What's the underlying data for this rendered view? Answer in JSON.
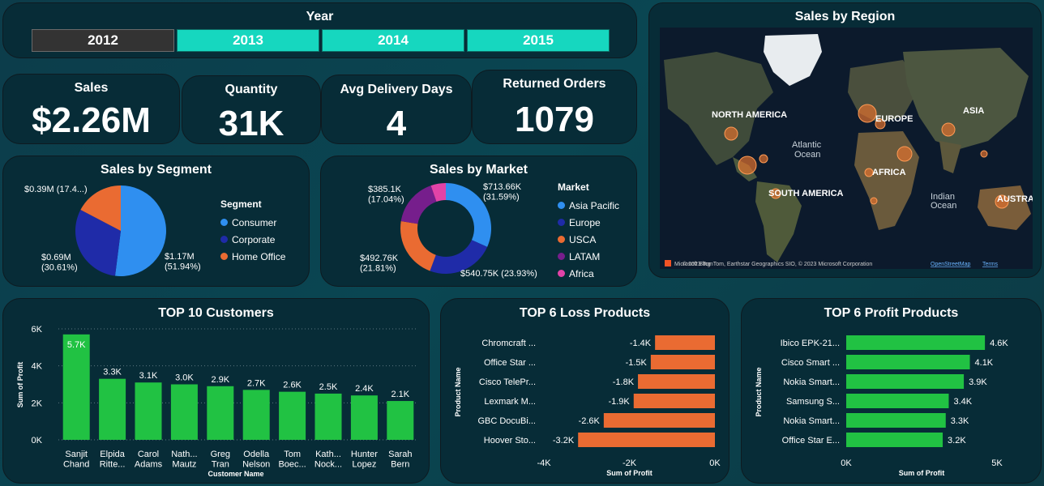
{
  "year_slicer": {
    "title": "Year",
    "years": [
      "2012",
      "2013",
      "2014",
      "2015"
    ],
    "selected": "2012"
  },
  "kpis": [
    {
      "label": "Sales",
      "value": "$2.26M"
    },
    {
      "label": "Quantity",
      "value": "31K"
    },
    {
      "label": "Avg Delivery Days",
      "value": "4"
    },
    {
      "label": "Returned Orders",
      "value": "1079"
    }
  ],
  "map": {
    "title": "Sales by Region",
    "labels": [
      "NORTH AMERICA",
      "EUROPE",
      "ASIA",
      "AFRICA",
      "SOUTH AMERICA",
      "AUSTRA",
      "Atlantic",
      "Ocean",
      "Indian",
      "Ocean"
    ],
    "attribution": "© 2023 TomTom, Earthstar Geographics SIO, © 2023 Microsoft Corporation",
    "attribution_links": [
      "OpenStreetMap",
      "Terms"
    ],
    "logo_text": "Microsoft Bing"
  },
  "colors": {
    "consumer": "#2f8ff0",
    "corporate": "#1f2ba8",
    "home_office": "#ea6b32",
    "asia_pacific": "#2f8ff0",
    "europe": "#1f2ba8",
    "usca": "#ea6b32",
    "latam": "#761e8c",
    "africa": "#e243a7",
    "green_bar": "#21c243",
    "orange_bar": "#ea6b32"
  },
  "chart_data": [
    {
      "type": "pie",
      "title": "Sales by Segment",
      "legend_title": "Segment",
      "legend_position": "right",
      "labels": [
        "Consumer",
        "Corporate",
        "Home Office"
      ],
      "values": [
        1.17,
        0.69,
        0.39
      ],
      "unit": "$M",
      "data_labels": [
        "$1.17M\n(51.94%)",
        "$0.69M\n(30.61%)",
        "$0.39M (17.4...)"
      ]
    },
    {
      "type": "pie",
      "subtype": "donut",
      "title": "Sales by Market",
      "legend_title": "Market",
      "legend_position": "right",
      "labels": [
        "Asia Pacific",
        "Europe",
        "USCA",
        "LATAM",
        "Africa"
      ],
      "values": [
        713.66,
        540.75,
        492.76,
        385.1,
        120.3
      ],
      "unit": "$K",
      "data_labels": [
        "$713.66K\n(31.59%)",
        "$540.75K (23.93%)",
        "$492.76K\n(21.81%)",
        "$385.1K\n(17.04%)",
        ""
      ]
    },
    {
      "type": "bar",
      "title": "TOP 10 Customers",
      "xlabel": "Customer Name",
      "ylabel": "Sum of Profit",
      "categories": [
        "Sanjit\nChand",
        "Elpida\nRitte...",
        "Carol\nAdams",
        "Nath...\nMautz",
        "Greg\nTran",
        "Odella\nNelson",
        "Tom\nBoec...",
        "Kath...\nNock...",
        "Hunter\nLopez",
        "Sarah\nBern"
      ],
      "values": [
        5700,
        3300,
        3100,
        3000,
        2900,
        2700,
        2600,
        2500,
        2400,
        2100
      ],
      "value_labels": [
        "5.7K",
        "3.3K",
        "3.1K",
        "3.0K",
        "2.9K",
        "2.7K",
        "2.6K",
        "2.5K",
        "2.4K",
        "2.1K"
      ],
      "yticks": [
        "0K",
        "2K",
        "4K",
        "6K"
      ],
      "ylim": [
        0,
        6000
      ],
      "grid": true
    },
    {
      "type": "bar",
      "orientation": "horizontal",
      "title": "TOP 6 Loss Products",
      "xlabel": "Sum of Profit",
      "ylabel": "Product Name",
      "categories": [
        "Chromcraft ...",
        "Office Star ...",
        "Cisco TelePr...",
        "Lexmark M...",
        "GBC DocuBi...",
        "Hoover Sto..."
      ],
      "values": [
        -1400,
        -1500,
        -1800,
        -1900,
        -2600,
        -3200
      ],
      "value_labels": [
        "-1.4K",
        "-1.5K",
        "-1.8K",
        "-1.9K",
        "-2.6K",
        "-3.2K"
      ],
      "xticks": [
        "-4K",
        "-2K",
        "0K"
      ],
      "xlim": [
        -4000,
        0
      ]
    },
    {
      "type": "bar",
      "orientation": "horizontal",
      "title": "TOP 6 Profit Products",
      "xlabel": "Sum of Profit",
      "ylabel": "Product Name",
      "categories": [
        "Ibico EPK-21...",
        "Cisco Smart ...",
        "Nokia Smart...",
        "Samsung S...",
        "Nokia Smart...",
        "Office Star E..."
      ],
      "values": [
        4600,
        4100,
        3900,
        3400,
        3300,
        3200
      ],
      "value_labels": [
        "4.6K",
        "4.1K",
        "3.9K",
        "3.4K",
        "3.3K",
        "3.2K"
      ],
      "xticks": [
        "0K",
        "5K"
      ],
      "xlim": [
        0,
        5000
      ]
    }
  ]
}
